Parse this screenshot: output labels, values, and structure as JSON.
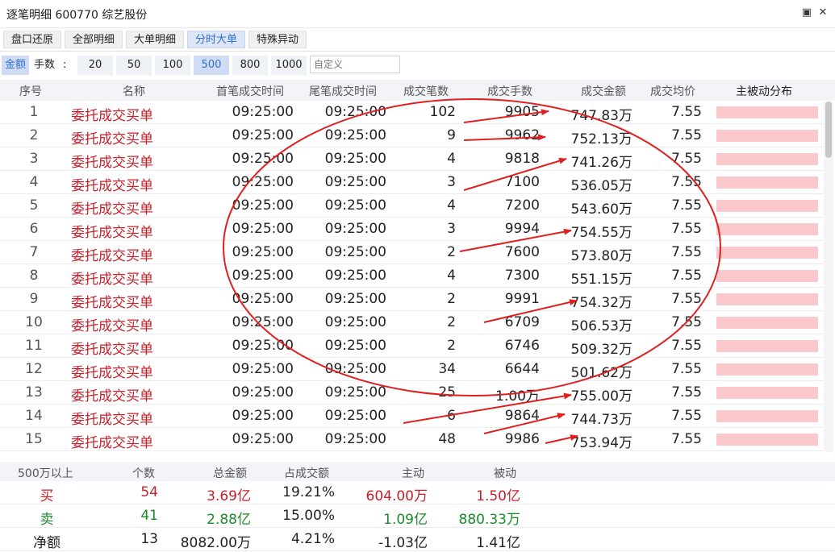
{
  "window": {
    "title": "逐笔明细 600770 综艺股份",
    "restore_icon": "restore-icon",
    "close_icon": "close-icon"
  },
  "tabs": [
    {
      "label": "盘口还原",
      "active": false
    },
    {
      "label": "全部明细",
      "active": false
    },
    {
      "label": "大单明细",
      "active": false
    },
    {
      "label": "分时大单",
      "active": true
    },
    {
      "label": "特殊异动",
      "active": false
    }
  ],
  "filter": {
    "amount_label": "金额",
    "lots_label": "手数",
    "colon": ":",
    "options": [
      "20",
      "50",
      "100",
      "500",
      "800",
      "1000"
    ],
    "selected": "500",
    "custom_placeholder": "自定义"
  },
  "table": {
    "headers": [
      "序号",
      "名称",
      "首笔成交时间",
      "尾笔成交时间",
      "成交笔数",
      "成交手数",
      "成交金额",
      "成交均价",
      "主被动分布"
    ],
    "rows": [
      {
        "no": "1",
        "name": "委托成交买单",
        "first": "09:25:00",
        "last": "09:25:00",
        "count": "102",
        "lots": "9905",
        "amount": "747.83万",
        "avg": "7.55",
        "buy_share": 1.0
      },
      {
        "no": "2",
        "name": "委托成交买单",
        "first": "09:25:00",
        "last": "09:25:00",
        "count": "9",
        "lots": "9962",
        "amount": "752.13万",
        "avg": "7.55",
        "buy_share": 1.0
      },
      {
        "no": "3",
        "name": "委托成交买单",
        "first": "09:25:00",
        "last": "09:25:00",
        "count": "4",
        "lots": "9818",
        "amount": "741.26万",
        "avg": "7.55",
        "buy_share": 1.0
      },
      {
        "no": "4",
        "name": "委托成交买单",
        "first": "09:25:00",
        "last": "09:25:00",
        "count": "3",
        "lots": "7100",
        "amount": "536.05万",
        "avg": "7.55",
        "buy_share": 1.0
      },
      {
        "no": "5",
        "name": "委托成交买单",
        "first": "09:25:00",
        "last": "09:25:00",
        "count": "4",
        "lots": "7200",
        "amount": "543.60万",
        "avg": "7.55",
        "buy_share": 1.0
      },
      {
        "no": "6",
        "name": "委托成交买单",
        "first": "09:25:00",
        "last": "09:25:00",
        "count": "3",
        "lots": "9994",
        "amount": "754.55万",
        "avg": "7.55",
        "buy_share": 1.0
      },
      {
        "no": "7",
        "name": "委托成交买单",
        "first": "09:25:00",
        "last": "09:25:00",
        "count": "2",
        "lots": "7600",
        "amount": "573.80万",
        "avg": "7.55",
        "buy_share": 1.0
      },
      {
        "no": "8",
        "name": "委托成交买单",
        "first": "09:25:00",
        "last": "09:25:00",
        "count": "4",
        "lots": "7300",
        "amount": "551.15万",
        "avg": "7.55",
        "buy_share": 1.0
      },
      {
        "no": "9",
        "name": "委托成交买单",
        "first": "09:25:00",
        "last": "09:25:00",
        "count": "2",
        "lots": "9991",
        "amount": "754.32万",
        "avg": "7.55",
        "buy_share": 1.0
      },
      {
        "no": "10",
        "name": "委托成交买单",
        "first": "09:25:00",
        "last": "09:25:00",
        "count": "2",
        "lots": "6709",
        "amount": "506.53万",
        "avg": "7.55",
        "buy_share": 1.0
      },
      {
        "no": "11",
        "name": "委托成交买单",
        "first": "09:25:00",
        "last": "09:25:00",
        "count": "2",
        "lots": "6746",
        "amount": "509.32万",
        "avg": "7.55",
        "buy_share": 1.0
      },
      {
        "no": "12",
        "name": "委托成交买单",
        "first": "09:25:00",
        "last": "09:25:00",
        "count": "34",
        "lots": "6644",
        "amount": "501.62万",
        "avg": "7.55",
        "buy_share": 1.0
      },
      {
        "no": "13",
        "name": "委托成交买单",
        "first": "09:25:00",
        "last": "09:25:00",
        "count": "25",
        "lots": "1.00万",
        "amount": "755.00万",
        "avg": "7.55",
        "buy_share": 1.0
      },
      {
        "no": "14",
        "name": "委托成交买单",
        "first": "09:25:00",
        "last": "09:25:00",
        "count": "6",
        "lots": "9864",
        "amount": "744.73万",
        "avg": "7.55",
        "buy_share": 1.0
      },
      {
        "no": "15",
        "name": "委托成交买单",
        "first": "09:25:00",
        "last": "09:25:00",
        "count": "48",
        "lots": "9986",
        "amount": "753.94万",
        "avg": "7.55",
        "buy_share": 1.0
      }
    ]
  },
  "summary": {
    "headers": [
      "500万以上",
      "个数",
      "总金额",
      "占成交额",
      "主动",
      "被动"
    ],
    "rows": [
      {
        "label": "买",
        "count": "54",
        "total": "3.69亿",
        "share": "19.21%",
        "active": "604.00万",
        "passive": "1.50亿",
        "color": "#c8202a"
      },
      {
        "label": "卖",
        "count": "41",
        "total": "2.88亿",
        "share": "15.00%",
        "active": "1.09亿",
        "passive": "880.33万",
        "color": "#1a8a2a"
      },
      {
        "label": "净额",
        "count": "13",
        "total": "8082.00万",
        "share": "4.21%",
        "active": "-1.03亿",
        "passive": "1.41亿",
        "color": "#222222"
      }
    ]
  },
  "colors": {
    "buy_red": "#c8202a",
    "sell_green": "#1a8a2a",
    "bar_pink": "#fbc9cb",
    "annotation_red": "#e02020",
    "accent_blue": "#2f6fd0"
  }
}
